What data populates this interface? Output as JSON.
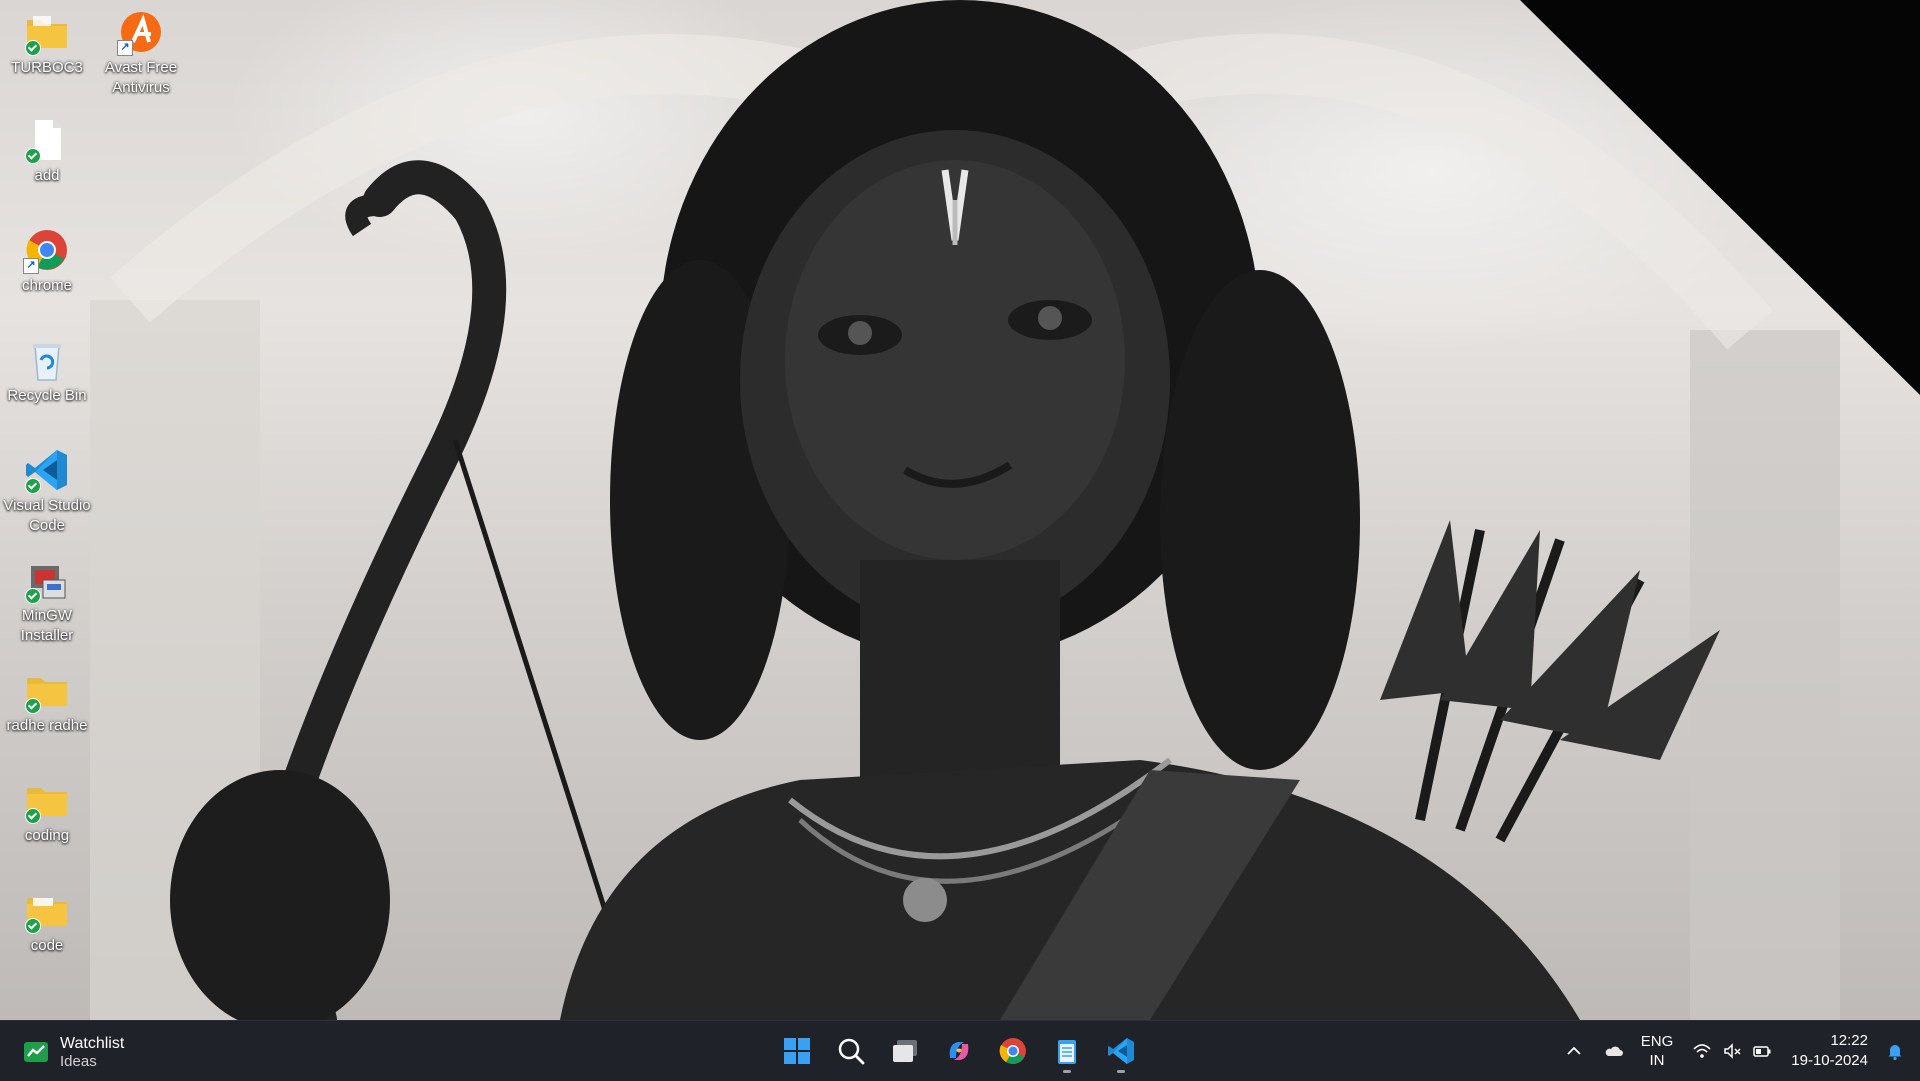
{
  "desktop": {
    "icons": [
      {
        "label": "TURBOC3",
        "icon": "folder-icon"
      },
      {
        "label": "Avast Free\nAntivirus",
        "icon": "avast-icon"
      },
      {
        "label": "add",
        "icon": "file-icon"
      },
      {
        "label": "chrome",
        "icon": "chrome-icon"
      },
      {
        "label": "Recycle Bin",
        "icon": "recycle-bin-icon"
      },
      {
        "label": "Visual Studio\nCode",
        "icon": "vscode-icon"
      },
      {
        "label": "MinGW\nInstaller",
        "icon": "mingw-icon"
      },
      {
        "label": "radhe radhe",
        "icon": "folder-icon"
      },
      {
        "label": "coding",
        "icon": "folder-icon"
      },
      {
        "label": "code",
        "icon": "folder-icon"
      }
    ]
  },
  "taskbar": {
    "widget": {
      "title": "Watchlist",
      "subtitle": "Ideas"
    },
    "apps": [
      {
        "name": "Start",
        "icon": "windows-start-icon"
      },
      {
        "name": "Search",
        "icon": "search-icon"
      },
      {
        "name": "Task View",
        "icon": "task-view-icon"
      },
      {
        "name": "Copilot",
        "icon": "copilot-icon"
      },
      {
        "name": "Google Chrome",
        "icon": "chrome-icon"
      },
      {
        "name": "Notepad",
        "icon": "notepad-icon"
      },
      {
        "name": "Visual Studio Code",
        "icon": "vscode-icon"
      }
    ],
    "tray": {
      "language": "ENG",
      "region": "IN",
      "time": "12:22",
      "date": "19-10-2024"
    }
  },
  "colors": {
    "taskbar": "#1f2229",
    "accent": "#0078d4",
    "folder": "#f5c542"
  }
}
